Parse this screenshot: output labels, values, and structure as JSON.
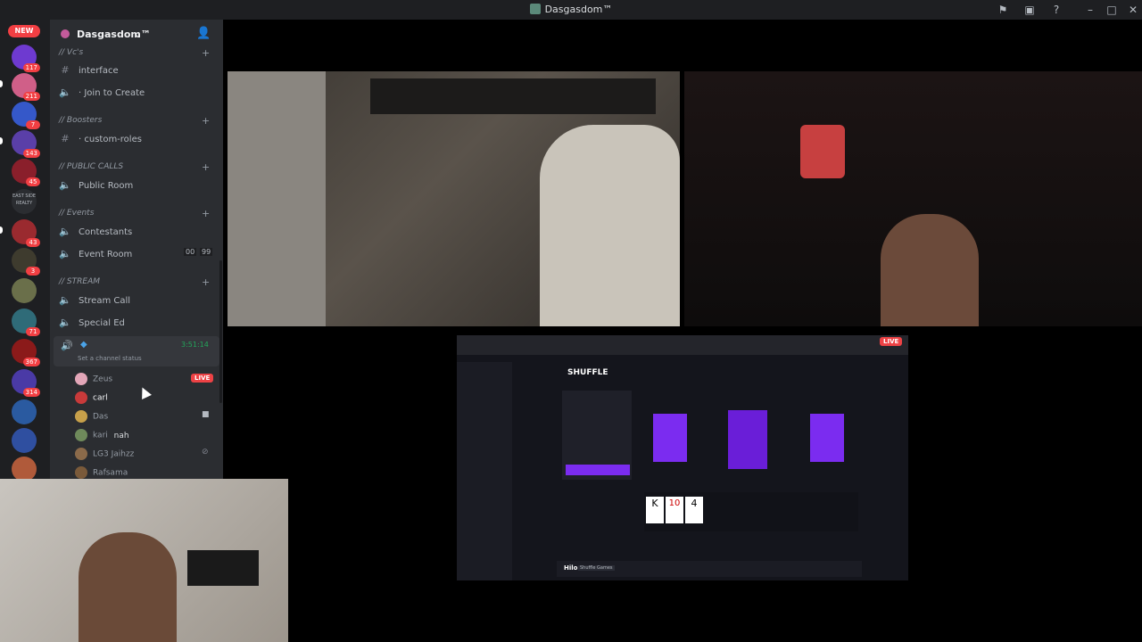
{
  "window": {
    "title": "Dasgasdom™"
  },
  "guild_rail": {
    "new_badge": "NEW",
    "badges": [
      "117",
      "211",
      "7",
      "143",
      "45",
      "43",
      "3",
      "71",
      "367",
      "314"
    ],
    "label_text": "EAST SIDE REALTY"
  },
  "server": {
    "name": "Dasgasdom™",
    "categories": [
      {
        "label": "// Vc's"
      },
      {
        "label": "// Boosters"
      },
      {
        "label": "// PUBLIC CALLS"
      },
      {
        "label": "// Events"
      },
      {
        "label": "// STREAM"
      }
    ],
    "channels": {
      "interface": "interface",
      "join_to_create": "· Join to Create",
      "custom_roles": "· custom-roles",
      "public_room": "Public Room",
      "contestants": "Contestants",
      "event_room": "Event Room",
      "event_room_count_a": "00",
      "event_room_count_b": "99",
      "stream_call": "Stream Call",
      "special_ed": "Special Ed",
      "active_timer": "3:51:14",
      "channel_status": "Set a channel status"
    },
    "voice_users": [
      {
        "name": "Zeus",
        "live": "LIVE"
      },
      {
        "name": "carl"
      },
      {
        "name": "Das"
      },
      {
        "name": "kari",
        "extra": "nah"
      },
      {
        "name": "LG3 Jaihzz"
      },
      {
        "name": "Rafsama"
      }
    ]
  },
  "stream": {
    "live_label": "LIVE",
    "site_name": "SHUFFLE",
    "cards": [
      "K",
      "10",
      "4"
    ],
    "game_title": "Hilo",
    "game_provider": "Shuffle Games"
  },
  "colors": {
    "guild_rail": "#1e1f22",
    "sidebar": "#2b2d31",
    "accent_live": "#ed4245",
    "shuffle_purple": "#7b2cf0"
  }
}
